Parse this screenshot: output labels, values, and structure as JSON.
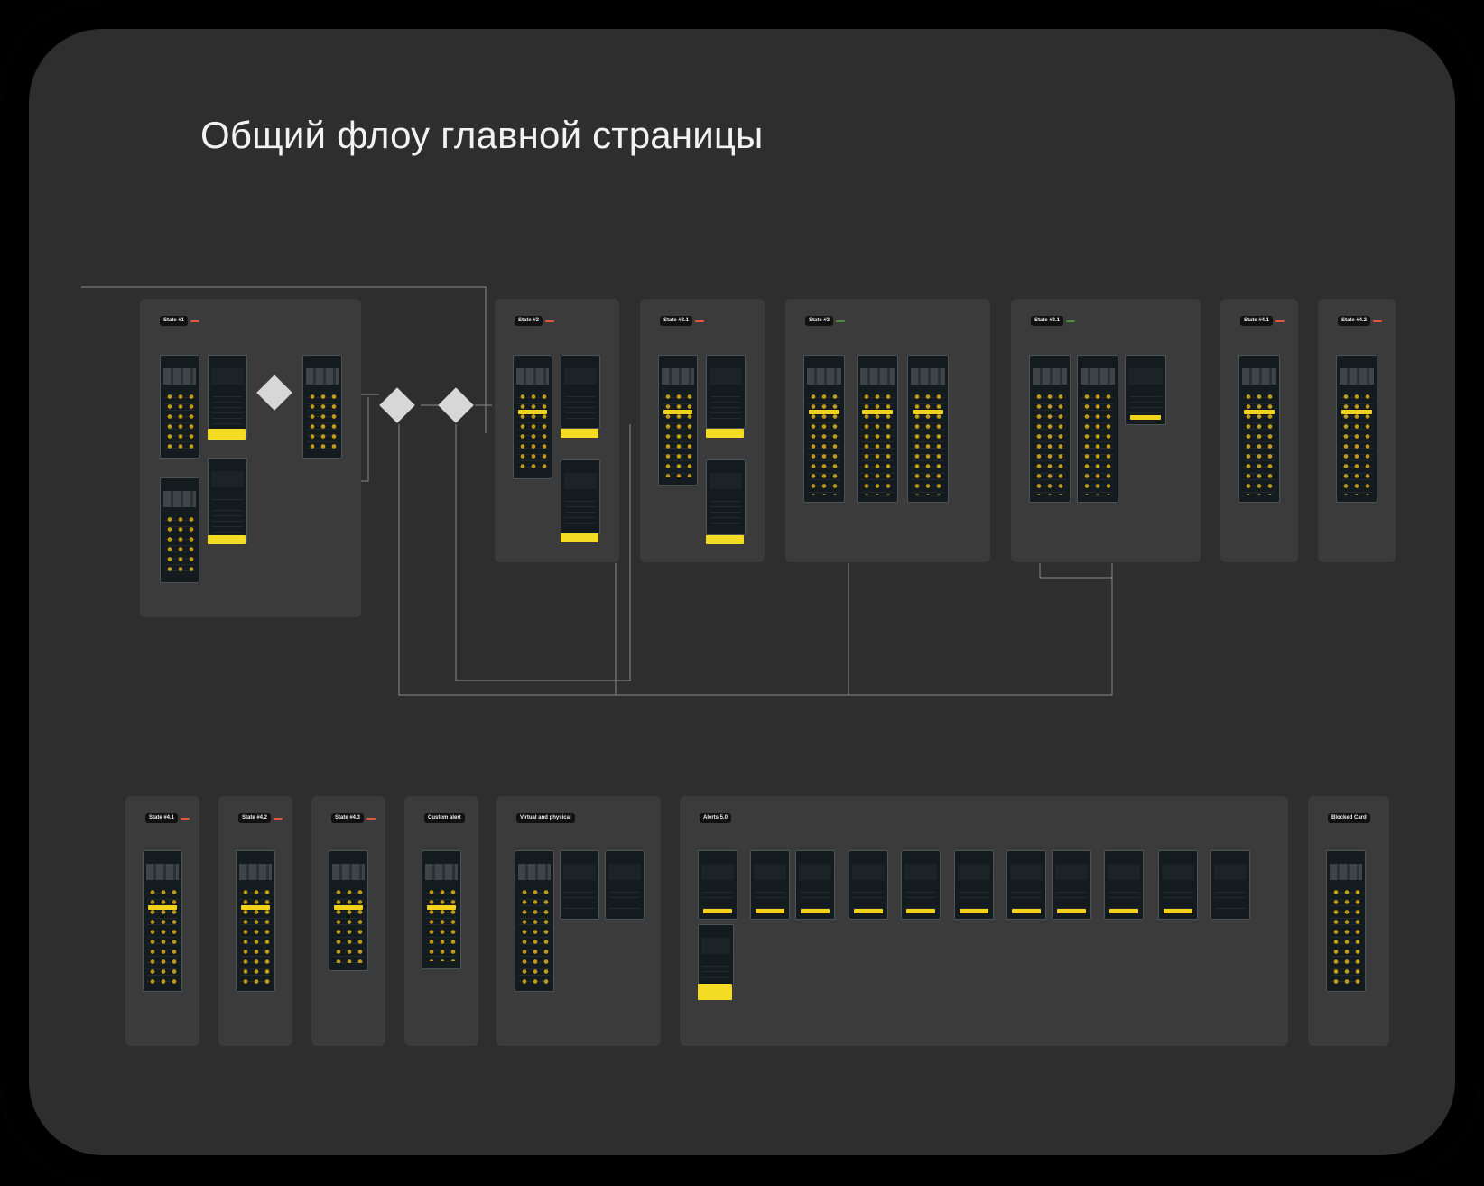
{
  "title": "Общий флоу главной страницы",
  "colors": {
    "background": "#2e2e2e",
    "frame": "#3b3b3b",
    "badge_red": "#e5573b",
    "badge_green": "#4b8f3a",
    "highlight": "#f4dc25"
  },
  "frames_top": [
    {
      "id": "state-1",
      "tag": "State #1",
      "badge": "",
      "badge_color": "red",
      "desc": ""
    },
    {
      "id": "state-2",
      "tag": "State #2",
      "badge": "",
      "badge_color": "red",
      "desc": ""
    },
    {
      "id": "state-2-1",
      "tag": "State #2.1",
      "badge": "",
      "badge_color": "red",
      "desc": ""
    },
    {
      "id": "state-3",
      "tag": "State #3",
      "badge": "",
      "badge_color": "green",
      "desc": ""
    },
    {
      "id": "state-3-1",
      "tag": "State #3.1",
      "badge": "",
      "badge_color": "green",
      "desc": ""
    },
    {
      "id": "state-4-1",
      "tag": "State #4.1",
      "badge": "",
      "badge_color": "red",
      "desc": ""
    },
    {
      "id": "state-4-2",
      "tag": "State #4.2",
      "badge": "",
      "badge_color": "red",
      "desc": ""
    }
  ],
  "frames_bottom": [
    {
      "id": "state-4-1b",
      "tag": "State #4.1",
      "badge": "",
      "badge_color": "red",
      "desc": ""
    },
    {
      "id": "state-4-2b",
      "tag": "State #4.2",
      "badge": "",
      "badge_color": "red",
      "desc": ""
    },
    {
      "id": "state-4-3",
      "tag": "State #4.3",
      "badge": "",
      "badge_color": "red",
      "desc": ""
    },
    {
      "id": "custom-alert",
      "tag": "Custom alert",
      "badge": "",
      "badge_color": "",
      "desc": ""
    },
    {
      "id": "virtual-physical",
      "tag": "Virtual and physical",
      "badge": "",
      "badge_color": "",
      "desc": ""
    },
    {
      "id": "alerts",
      "tag": "Alerts 5.0",
      "badge": "",
      "badge_color": "",
      "desc": ""
    },
    {
      "id": "blocked-card",
      "tag": "Blocked Card",
      "badge": "",
      "badge_color": "",
      "desc": ""
    }
  ],
  "decisions": [
    {
      "label": ""
    },
    {
      "label": ""
    },
    {
      "label": ""
    }
  ]
}
